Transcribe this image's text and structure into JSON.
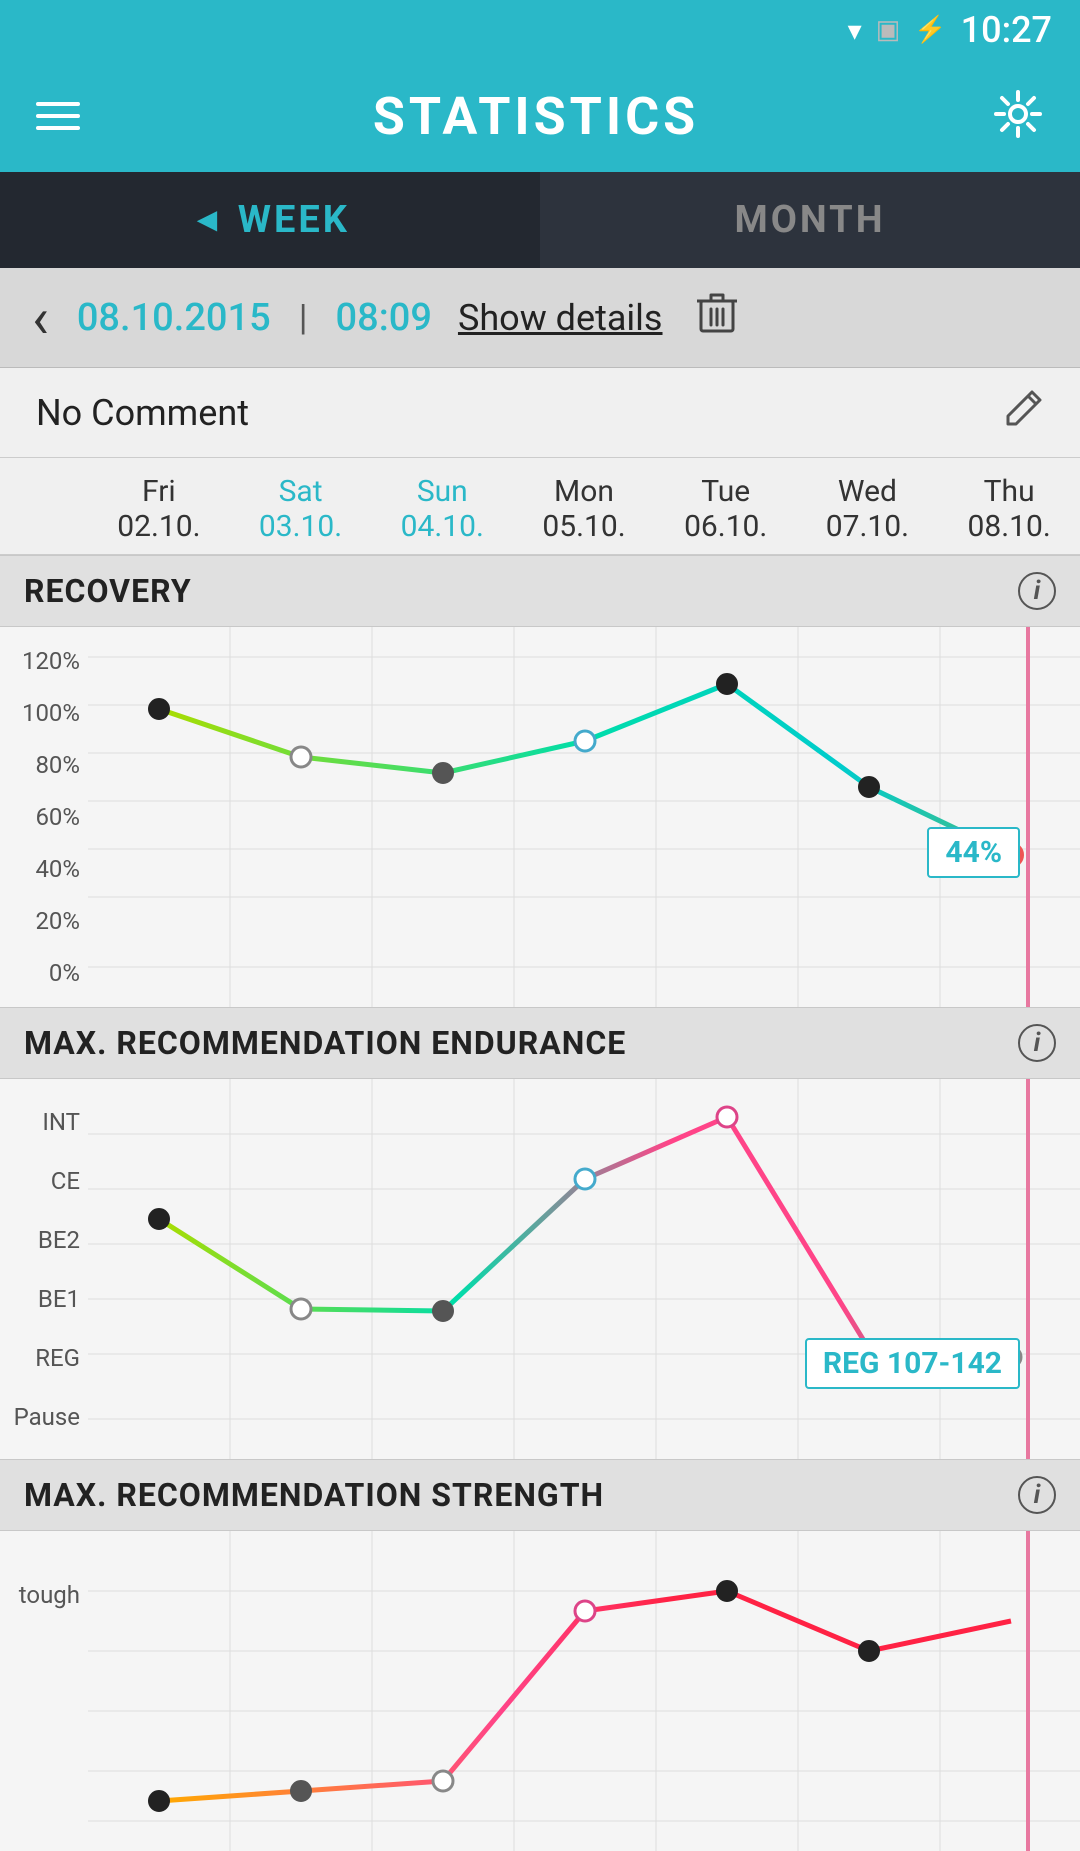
{
  "statusBar": {
    "time": "10:27",
    "wifiIcon": "wifi-icon",
    "batteryIcon": "battery-icon",
    "simIcon": "sim-icon"
  },
  "appBar": {
    "title": "STATISTICS",
    "hamburgerIcon": "hamburger-icon",
    "settingsIcon": "gear-icon"
  },
  "tabs": [
    {
      "label": "WEEK",
      "active": true,
      "arrow": "◄"
    },
    {
      "label": "MONTH",
      "active": false
    }
  ],
  "dateNav": {
    "date": "08.10.2015",
    "separator": "|",
    "time": "08:09",
    "showDetails": "Show details",
    "backArrow": "‹",
    "deleteIcon": "🗑"
  },
  "comment": {
    "text": "No Comment",
    "editIcon": "✏"
  },
  "days": [
    {
      "name": "Fri",
      "date": "02.10.",
      "weekend": false
    },
    {
      "name": "Sat",
      "date": "03.10.",
      "weekend": true
    },
    {
      "name": "Sun",
      "date": "04.10.",
      "weekend": true
    },
    {
      "name": "Mon",
      "date": "05.10.",
      "weekend": false
    },
    {
      "name": "Tue",
      "date": "06.10.",
      "weekend": false
    },
    {
      "name": "Wed",
      "date": "07.10.",
      "weekend": false
    },
    {
      "name": "Thu",
      "date": "08.10.",
      "weekend": false
    }
  ],
  "sections": {
    "recovery": {
      "title": "RECOVERY",
      "infoLabel": "i",
      "yLabels": [
        "120%",
        "100%",
        "80%",
        "60%",
        "40%",
        "20%",
        "0%"
      ],
      "tooltip": "44%",
      "tooltipColor": "#2ab8c8"
    },
    "endurance": {
      "title": "MAX. RECOMMENDATION ENDURANCE",
      "infoLabel": "i",
      "yLabels": [
        "INT",
        "CE",
        "BE2",
        "BE1",
        "REG",
        "Pause"
      ],
      "tooltip": "REG 107-142",
      "tooltipColor": "#2ab8c8"
    },
    "strength": {
      "title": "MAX. RECOMMENDATION STRENGTH",
      "infoLabel": "i",
      "yLabels": [
        "tough"
      ]
    }
  }
}
